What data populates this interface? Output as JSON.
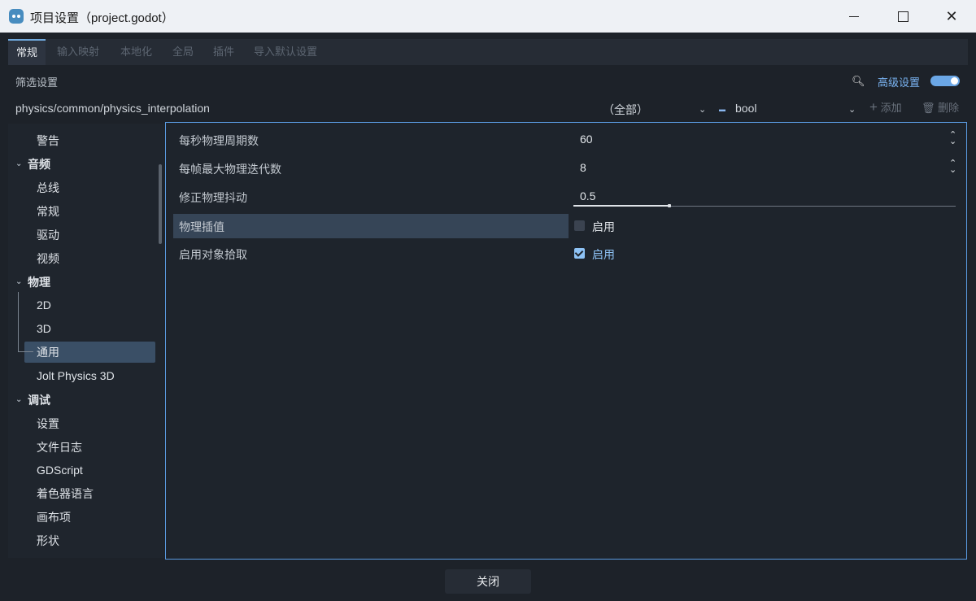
{
  "window": {
    "title": "项目设置（project.godot）",
    "min_icon": "minimize-icon",
    "max_icon": "maximize-icon",
    "close_symbol": "✕"
  },
  "tabs": [
    "常规",
    "输入映射",
    "本地化",
    "全局",
    "插件",
    "导入默认设置"
  ],
  "toolbar": {
    "filter_placeholder": "筛选设置",
    "advanced_label": "高级设置",
    "advanced_enabled": true,
    "property_path": "physics/common/physics_interpolation",
    "type_filter": "（全部）",
    "value_type": "bool",
    "add_label": "添加",
    "delete_label": "删除"
  },
  "sidebar": {
    "items": [
      {
        "label": "警告",
        "level": 1
      },
      {
        "label": "音频",
        "level": 0,
        "expanded": true
      },
      {
        "label": "总线",
        "level": 1
      },
      {
        "label": "常规",
        "level": 1
      },
      {
        "label": "驱动",
        "level": 1
      },
      {
        "label": "视频",
        "level": 1
      },
      {
        "label": "物理",
        "level": 0,
        "expanded": true
      },
      {
        "label": "2D",
        "level": 1
      },
      {
        "label": "3D",
        "level": 1
      },
      {
        "label": "通用",
        "level": 1,
        "selected": true
      },
      {
        "label": "Jolt Physics 3D",
        "level": 1
      },
      {
        "label": "调试",
        "level": 0,
        "expanded": true
      },
      {
        "label": "设置",
        "level": 1
      },
      {
        "label": "文件日志",
        "level": 1
      },
      {
        "label": "GDScript",
        "level": 1
      },
      {
        "label": "着色器语言",
        "level": 1
      },
      {
        "label": "画布项",
        "level": 1
      },
      {
        "label": "形状",
        "level": 1
      }
    ]
  },
  "properties": [
    {
      "label": "每秒物理周期数",
      "value": "60",
      "kind": "spin"
    },
    {
      "label": "每帧最大物理迭代数",
      "value": "8",
      "kind": "spin"
    },
    {
      "label": "修正物理抖动",
      "value": "0.5",
      "kind": "slider",
      "fraction": 0.25
    },
    {
      "label": "物理插值",
      "check_label": "启用",
      "checked": false,
      "highlighted": true
    },
    {
      "label": "启用对象拾取",
      "check_label": "启用",
      "checked": true
    }
  ],
  "footer": {
    "close_label": "关闭"
  },
  "colors": {
    "accent": "#6fa8dc",
    "selected": "#3a4f66",
    "checked": "#8ec2f5"
  }
}
